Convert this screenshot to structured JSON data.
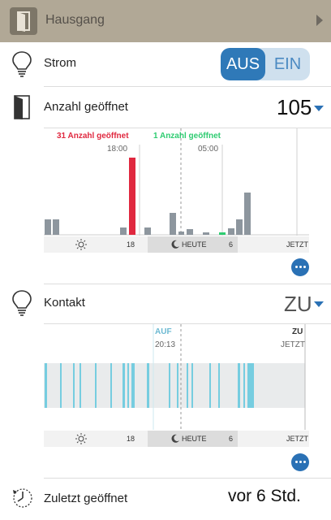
{
  "header": {
    "title": "Hausgang"
  },
  "strom": {
    "label": "Strom",
    "off_label": "AUS",
    "on_label": "EIN",
    "state": "AUS"
  },
  "count": {
    "label": "Anzahl geöffnet",
    "value": "105",
    "annotation_red": {
      "text": "31 Anzahl geöffnet",
      "time": "18:00"
    },
    "annotation_green": {
      "text": "1 Anzahl geöffnet",
      "time": "05:00"
    },
    "axis": {
      "hour_left": "18",
      "today": "HEUTE",
      "hour_right": "6",
      "now": "JETZT"
    }
  },
  "kontakt": {
    "label": "Kontakt",
    "value": "ZU",
    "annotation_open": {
      "text": "AUF",
      "time": "20:13"
    },
    "annotation_closed": {
      "text": "ZU",
      "time": "JETZT"
    },
    "axis": {
      "hour_left": "18",
      "today": "HEUTE",
      "hour_right": "6",
      "now": "JETZT"
    }
  },
  "zuletzt": {
    "label": "Zuletzt geöffnet",
    "value": "vor 6 Std."
  },
  "colors": {
    "accent": "#2a71b5",
    "red": "#e0283f",
    "green": "#2ecc71",
    "bar": "#8d969e",
    "contact": "#76cde0"
  },
  "icons": {
    "header": "door-icon",
    "strom": "lightbulb-icon",
    "count": "door-open-icon",
    "kontakt": "lightbulb-icon",
    "zuletzt": "clock-history-icon"
  }
}
